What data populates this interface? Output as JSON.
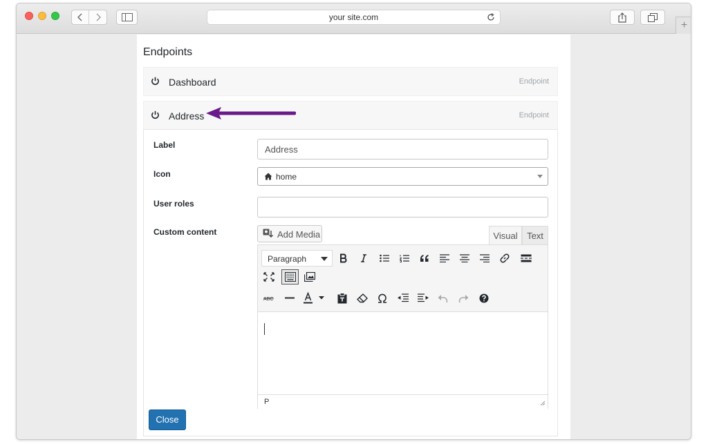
{
  "browser": {
    "url": "your site.com",
    "colors": {
      "close": "#fc605c",
      "minimize": "#fdbc40",
      "zoom": "#34c84a"
    }
  },
  "page": {
    "heading": "Endpoints",
    "endpoints": [
      {
        "name": "Dashboard",
        "type": "Endpoint"
      },
      {
        "name": "Address",
        "type": "Endpoint"
      }
    ]
  },
  "form": {
    "label_label": "Label",
    "label_value": "Address",
    "icon_label": "Icon",
    "icon_value": "home",
    "roles_label": "User roles",
    "roles_value": "",
    "custom_label": "Custom content",
    "add_media": "Add Media",
    "tab_visual": "Visual",
    "tab_text": "Text",
    "format_select": "Paragraph",
    "status_path": "P",
    "close_button": "Close"
  },
  "toolbar_icons": [
    "bold-icon",
    "italic-icon",
    "bullet-list-icon",
    "numbered-list-icon",
    "blockquote-icon",
    "align-left-icon",
    "align-center-icon",
    "align-right-icon",
    "link-icon",
    "read-more-icon",
    "fullscreen-icon",
    "toolbar-toggle-icon",
    "image-icon",
    "strikethrough-icon",
    "horizontal-line-icon",
    "text-color-icon",
    "paste-text-icon",
    "clear-formatting-icon",
    "special-character-icon",
    "outdent-icon",
    "indent-icon",
    "undo-icon",
    "redo-icon",
    "help-icon"
  ],
  "accent_color": "#2271b1",
  "arrow_color": "#6a1b8a"
}
